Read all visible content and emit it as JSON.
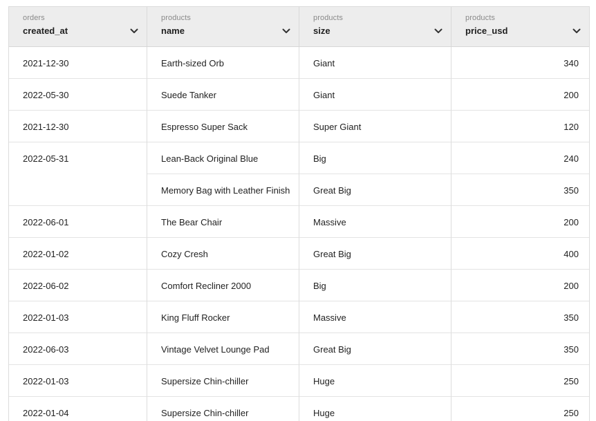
{
  "table": {
    "columns": [
      {
        "group": "orders",
        "name": "created_at"
      },
      {
        "group": "products",
        "name": "name"
      },
      {
        "group": "products",
        "name": "size"
      },
      {
        "group": "products",
        "name": "price_usd"
      }
    ],
    "rows": [
      {
        "created_at": "2021-12-30",
        "name": "Earth-sized Orb",
        "size": "Giant",
        "price_usd": "340"
      },
      {
        "created_at": "2022-05-30",
        "name": "Suede Tanker",
        "size": "Giant",
        "price_usd": "200"
      },
      {
        "created_at": "2021-12-30",
        "name": "Espresso Super Sack",
        "size": "Super Giant",
        "price_usd": "120"
      },
      {
        "created_at": "2022-05-31",
        "name": "Lean-Back Original Blue",
        "size": "Big",
        "price_usd": "240"
      },
      {
        "created_at": "",
        "name": "Memory Bag with Leather Finish",
        "size": "Great Big",
        "price_usd": "350"
      },
      {
        "created_at": "2022-06-01",
        "name": "The Bear Chair",
        "size": "Massive",
        "price_usd": "200"
      },
      {
        "created_at": "2022-01-02",
        "name": "Cozy Cresh",
        "size": "Great Big",
        "price_usd": "400"
      },
      {
        "created_at": "2022-06-02",
        "name": "Comfort Recliner 2000",
        "size": "Big",
        "price_usd": "200"
      },
      {
        "created_at": "2022-01-03",
        "name": "King Fluff Rocker",
        "size": "Massive",
        "price_usd": "350"
      },
      {
        "created_at": "2022-06-03",
        "name": "Vintage Velvet Lounge Pad",
        "size": "Great Big",
        "price_usd": "350"
      },
      {
        "created_at": "2022-01-03",
        "name": "Supersize Chin-chiller",
        "size": "Huge",
        "price_usd": "250"
      },
      {
        "created_at": "2022-01-04",
        "name": "Supersize Chin-chiller",
        "size": "Huge",
        "price_usd": "250"
      }
    ]
  },
  "icons": {
    "column_menu": "chevron-down-icon"
  }
}
